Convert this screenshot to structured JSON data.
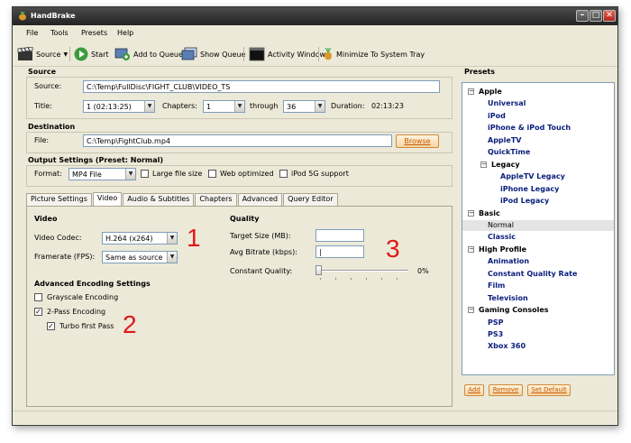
{
  "window": {
    "title": "HandBrake",
    "controls": {
      "minimize": "–",
      "maximize": "□",
      "close": "✕"
    }
  },
  "menubar": {
    "items": [
      {
        "label": "File"
      },
      {
        "label": "Tools"
      },
      {
        "label": "Presets"
      },
      {
        "label": "Help"
      }
    ]
  },
  "toolbar": {
    "source_label": "Source",
    "start_label": "Start",
    "add_to_queue_label": "Add to Queue",
    "show_queue_label": "Show Queue",
    "activity_window_label": "Activity Window",
    "minimize_tray_label": "Minimize To System Tray"
  },
  "source": {
    "section_title": "Source",
    "source_label": "Source:",
    "source_path": "C:\\Temp\\FullDisc\\FIGHT_CLUB\\VIDEO_TS",
    "title_label": "Title:",
    "title_value": "1 (02:13:25)",
    "chapters_label": "Chapters:",
    "chapter_start": "1",
    "through_label": "through",
    "chapter_end": "36",
    "duration_label": "Duration:",
    "duration_value": "02:13:23"
  },
  "destination": {
    "section_title": "Destination",
    "file_label": "File:",
    "file_path": "C:\\Temp\\FightClub.mp4",
    "browse_label": "Browse"
  },
  "output": {
    "section_title": "Output Settings (Preset: Normal)",
    "format_label": "Format:",
    "format_value": "MP4 File",
    "large_file_label": "Large file size",
    "web_optimized_label": "Web optimized",
    "ipod_label": "iPod 5G support"
  },
  "tabs": [
    {
      "label": "Picture Settings"
    },
    {
      "label": "Video"
    },
    {
      "label": "Audio & Subtitles"
    },
    {
      "label": "Chapters"
    },
    {
      "label": "Advanced"
    },
    {
      "label": "Query Editor"
    }
  ],
  "video": {
    "heading": "Video",
    "codec_label": "Video Codec:",
    "codec_value": "H.264 (x264)",
    "framerate_label": "Framerate (FPS):",
    "framerate_value": "Same as source",
    "advanced_heading": "Advanced Encoding Settings",
    "grayscale_label": "Grayscale Encoding",
    "two_pass_label": "2-Pass Encoding",
    "turbo_label": "Turbo first Pass",
    "grayscale_checked": false,
    "two_pass_checked": true,
    "turbo_checked": true
  },
  "quality": {
    "heading": "Quality",
    "target_size_label": "Target Size (MB):",
    "target_size_value": "",
    "avg_bitrate_label": "Avg Bitrate (kbps):",
    "avg_bitrate_value": "|",
    "constant_quality_label": "Constant Quality:",
    "constant_quality_value": "0%",
    "constant_quality_level": 0
  },
  "annotations": [
    "1",
    "2",
    "3"
  ],
  "presets": {
    "title": "Presets",
    "tree": [
      {
        "label": "Apple",
        "group": true,
        "expander": "−"
      },
      {
        "label": "Universal"
      },
      {
        "label": "iPod"
      },
      {
        "label": "iPhone & iPod Touch"
      },
      {
        "label": "AppleTV"
      },
      {
        "label": "QuickTime"
      },
      {
        "label": "Legacy",
        "group": true,
        "expander": "−"
      },
      {
        "label": "AppleTV Legacy"
      },
      {
        "label": "iPhone Legacy"
      },
      {
        "label": "iPod Legacy"
      },
      {
        "label": "Basic",
        "group": true,
        "expander": "−"
      },
      {
        "label": "Normal",
        "selected": true
      },
      {
        "label": "Classic"
      },
      {
        "label": "High Profile",
        "group": true,
        "expander": "−"
      },
      {
        "label": "Animation"
      },
      {
        "label": "Constant Quality Rate"
      },
      {
        "label": "Film"
      },
      {
        "label": "Television"
      },
      {
        "label": "Gaming Consoles",
        "group": true,
        "expander": "−"
      },
      {
        "label": "PSP"
      },
      {
        "label": "PS3"
      },
      {
        "label": "Xbox 360"
      }
    ],
    "add_label": "Add",
    "remove_label": "Remove",
    "set_default_label": "Set Default"
  },
  "colors": {
    "accent_annotation": "#e01818",
    "preset_text": "#0a1e7c",
    "browse_text": "#c85a00"
  }
}
